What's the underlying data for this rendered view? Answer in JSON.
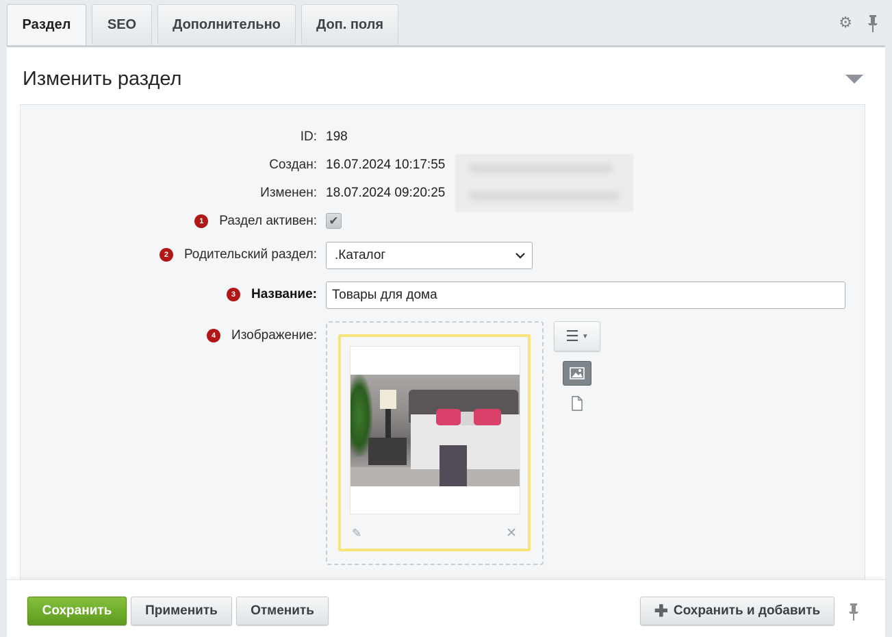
{
  "tabs": [
    {
      "label": "Раздел",
      "active": true
    },
    {
      "label": "SEO",
      "active": false
    },
    {
      "label": "Дополнительно",
      "active": false
    },
    {
      "label": "Доп. поля",
      "active": false
    }
  ],
  "header": {
    "settings_icon": "gear-icon",
    "pin_icon": "pin-icon"
  },
  "panel": {
    "title": "Изменить раздел",
    "toggle_icon": "triangle-down-icon"
  },
  "form": {
    "id": {
      "label": "ID:",
      "value": "198"
    },
    "created": {
      "label": "Создан:",
      "value": "16.07.2024 10:17:55"
    },
    "modified": {
      "label": "Изменен:",
      "value": "18.07.2024 09:20:25"
    },
    "active": {
      "badge": "1",
      "label": "Раздел активен:",
      "checked": true
    },
    "parent": {
      "badge": "2",
      "label": "Родительский раздел:",
      "selected": ".Каталог"
    },
    "name": {
      "badge": "3",
      "label": "Название:",
      "value": "Товары для дома"
    },
    "image": {
      "badge": "4",
      "label": "Изображение:"
    }
  },
  "footer": {
    "save": "Сохранить",
    "apply": "Применить",
    "cancel": "Отменить",
    "save_add": "Сохранить и добавить"
  },
  "colors": {
    "primary_button": "#6fae2a",
    "badge": "#b11717",
    "image_card_border": "#f7e47a"
  }
}
